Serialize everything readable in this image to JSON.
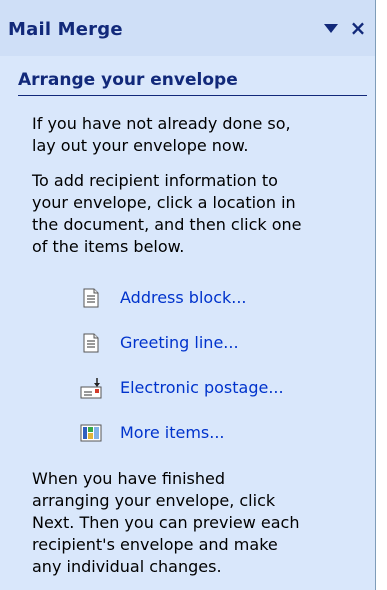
{
  "pane": {
    "title": "Mail Merge",
    "dropdown_icon": "chevron-down-icon",
    "close_symbol": "×"
  },
  "section": {
    "heading": "Arrange your envelope",
    "intro_lines": [
      "If you have not already done so,",
      "lay out your envelope now."
    ],
    "instruction_lines": [
      "To add recipient information to",
      "your envelope, click a location in",
      "the document, and then click one",
      "of the items below."
    ],
    "items": [
      {
        "label": "Address block...",
        "icon": "document-icon"
      },
      {
        "label": "Greeting line...",
        "icon": "document-icon"
      },
      {
        "label": "Electronic postage...",
        "icon": "postage-icon"
      },
      {
        "label": "More items...",
        "icon": "more-items-icon"
      }
    ],
    "finish_lines": [
      "When you have finished",
      "arranging your envelope, click",
      "Next. Then you can preview each",
      "recipient's envelope and make",
      "any individual changes."
    ]
  },
  "colors": {
    "pane_bg": "#d9e7fb",
    "title_text": "#12297a",
    "link": "#0033cc"
  }
}
